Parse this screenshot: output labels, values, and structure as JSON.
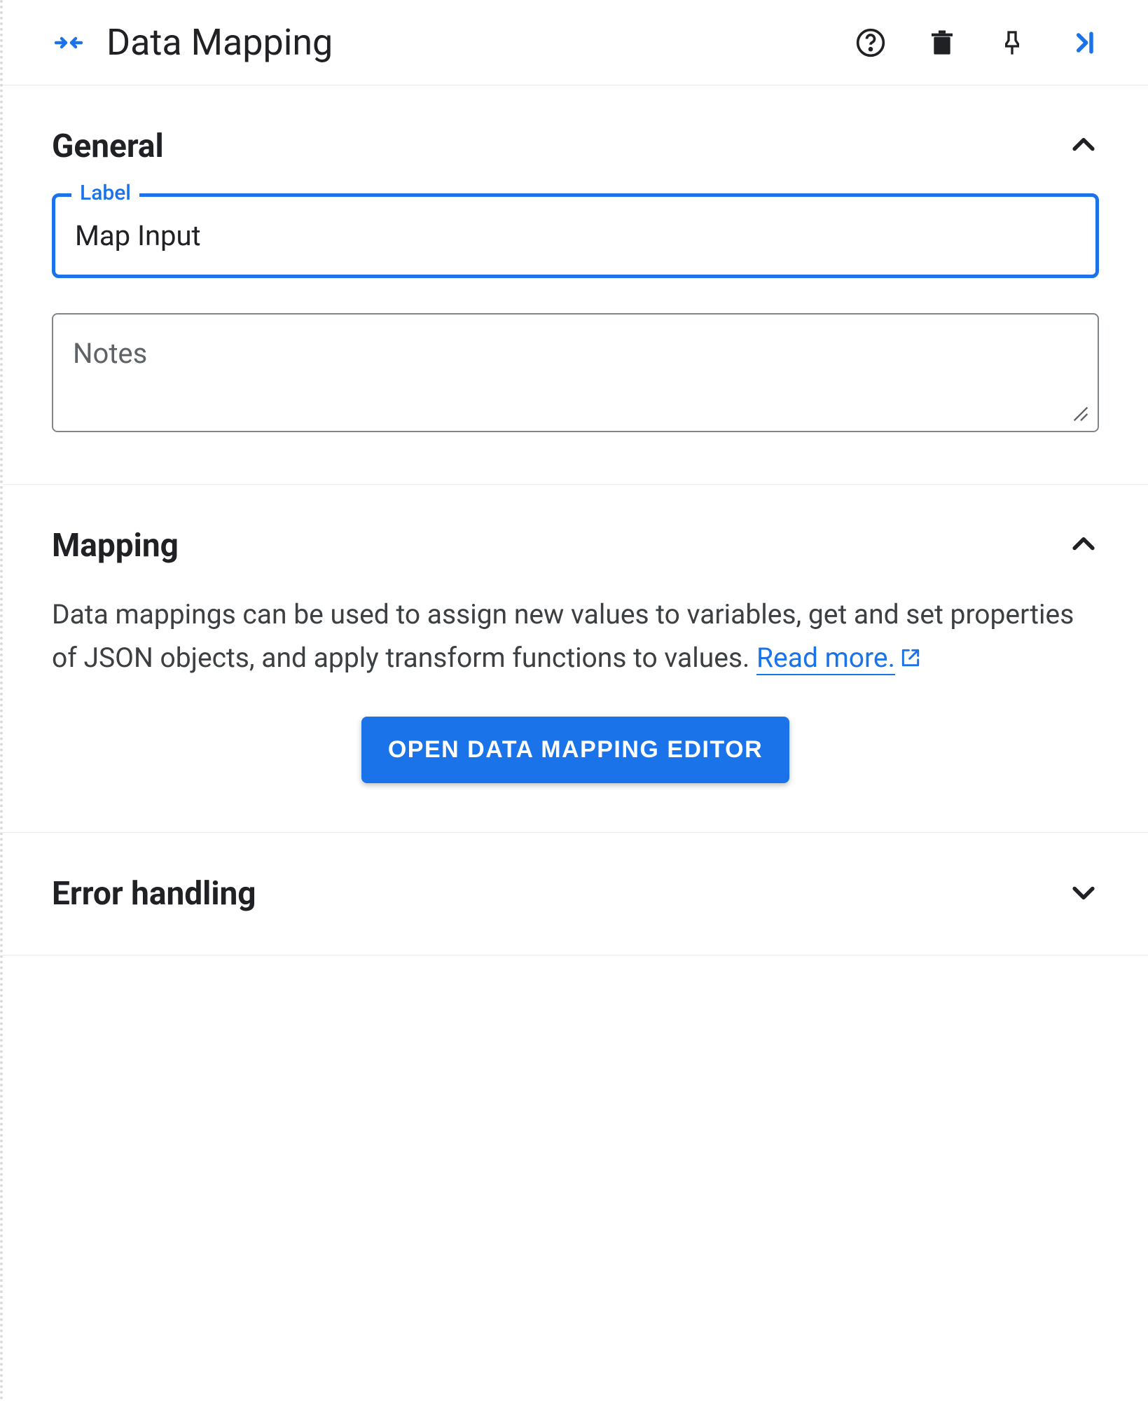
{
  "header": {
    "title": "Data Mapping"
  },
  "sections": {
    "general": {
      "title": "General",
      "label_field_label": "Label",
      "label_value": "Map Input",
      "notes_placeholder": "Notes"
    },
    "mapping": {
      "title": "Mapping",
      "description": "Data mappings can be used to assign new values to variables, get and set properties of JSON objects, and apply transform functions to values. ",
      "read_more": "Read more.",
      "button_label": "OPEN DATA MAPPING EDITOR"
    },
    "error_handling": {
      "title": "Error handling"
    }
  }
}
